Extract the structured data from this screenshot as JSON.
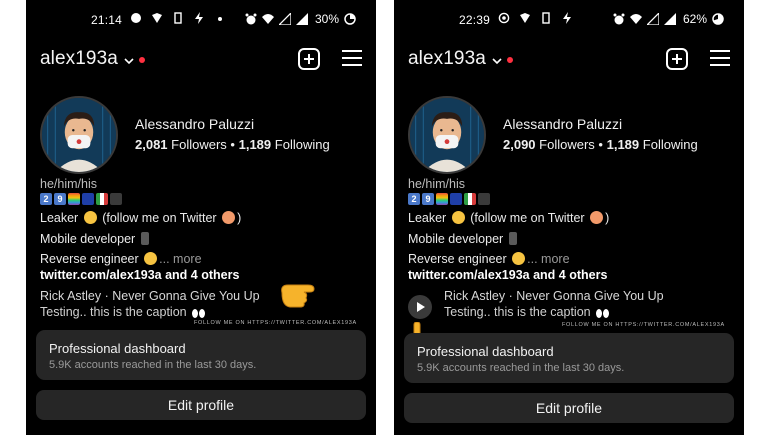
{
  "screens": [
    {
      "status": {
        "time": "21:14",
        "battery": "30%"
      },
      "header": {
        "username": "alex193a"
      },
      "profile": {
        "display_name": "Alessandro Paluzzi",
        "followers_count": "2,081",
        "followers_label": "Followers",
        "separator": "•",
        "following_count": "1,189",
        "following_label": "Following"
      },
      "bio": {
        "pronouns": "he/him/his",
        "tiles": [
          "2",
          "9"
        ],
        "line1": "Leaker",
        "line1_tail": "(follow me on Twitter",
        "line1_end": ")",
        "line2": "Mobile developer",
        "line3": "Reverse engineer",
        "more": "... more",
        "link": "twitter.com/alex193a and 4 others",
        "music": "Rick Astley · Never Gonna Give You Up",
        "caption": "Testing.. this is the caption"
      },
      "watermark": "FOLLOW ME ON HTTPS://TWITTER.COM/ALEX193A",
      "dashboard": {
        "title": "Professional dashboard",
        "subtitle": "5.9K accounts reached in the last 30 days."
      },
      "edit_profile": "Edit profile"
    },
    {
      "status": {
        "time": "22:39",
        "battery": "62%"
      },
      "header": {
        "username": "alex193a"
      },
      "profile": {
        "display_name": "Alessandro Paluzzi",
        "followers_count": "2,090",
        "followers_label": "Followers",
        "separator": "•",
        "following_count": "1,189",
        "following_label": "Following"
      },
      "bio": {
        "pronouns": "he/him/his",
        "tiles": [
          "2",
          "9"
        ],
        "line1": "Leaker",
        "line1_tail": "(follow me on Twitter",
        "line1_end": ")",
        "line2": "Mobile developer",
        "line3": "Reverse engineer",
        "more": "... more",
        "link": "twitter.com/alex193a and 4 others",
        "music": "Rick Astley · Never Gonna Give You Up",
        "caption": "Testing.. this is the caption"
      },
      "watermark": "FOLLOW ME ON HTTPS://TWITTER.COM/ALEX193A",
      "dashboard": {
        "title": "Professional dashboard",
        "subtitle": "5.9K accounts reached in the last 30 days."
      },
      "edit_profile": "Edit profile"
    }
  ],
  "colors": {
    "background": "#000000",
    "card": "#262626",
    "notification_dot": "#ff3040",
    "pointer_emoji": "#f6b32b"
  },
  "icons": [
    "alarm-icon",
    "wifi-icon",
    "signal-icon",
    "battery-icon",
    "new-post-icon",
    "menu-icon",
    "chevron-down-icon",
    "play-icon",
    "pointing-hand-icon"
  ]
}
